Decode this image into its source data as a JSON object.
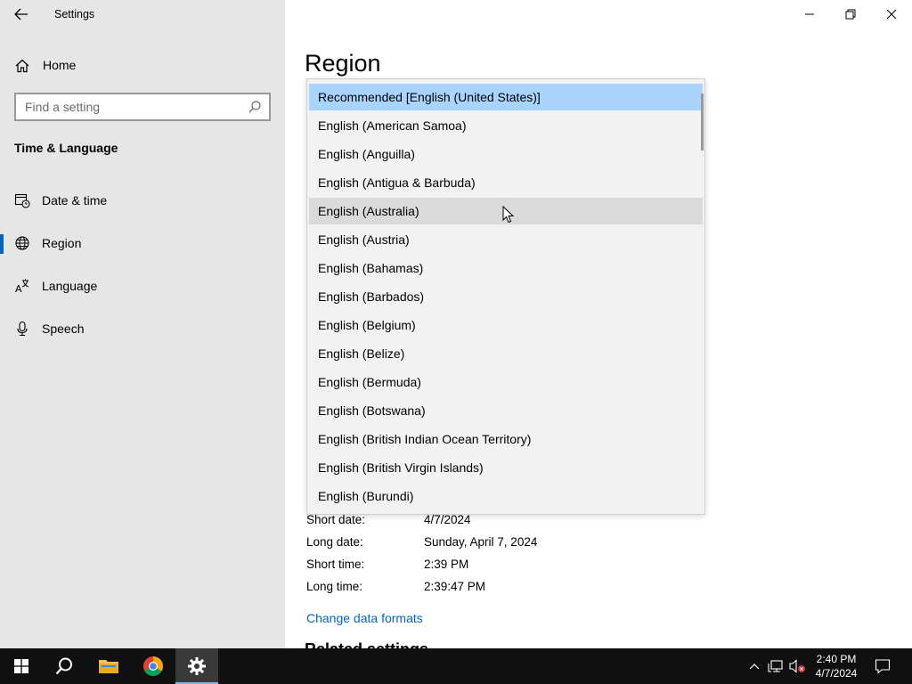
{
  "window": {
    "title": "Settings"
  },
  "sidebar": {
    "home_label": "Home",
    "search_placeholder": "Find a setting",
    "section_title": "Time & Language",
    "items": [
      {
        "label": "Date & time",
        "icon": "calendar-clock-icon"
      },
      {
        "label": "Region",
        "icon": "globe-icon",
        "active": true
      },
      {
        "label": "Language",
        "icon": "language-icon"
      },
      {
        "label": "Speech",
        "icon": "microphone-icon"
      }
    ]
  },
  "main": {
    "title": "Region",
    "dropdown": {
      "items": [
        "Recommended [English (United States)]",
        "English (American Samoa)",
        "English (Anguilla)",
        "English (Antigua & Barbuda)",
        "English (Australia)",
        "English (Austria)",
        "English (Bahamas)",
        "English (Barbados)",
        "English (Belgium)",
        "English (Belize)",
        "English (Bermuda)",
        "English (Botswana)",
        "English (British Indian Ocean Territory)",
        "English (British Virgin Islands)",
        "English (Burundi)"
      ],
      "selected_index": 0,
      "hover_index": 4
    },
    "formats": [
      {
        "label": "Short date:",
        "value": "4/7/2024"
      },
      {
        "label": "Long date:",
        "value": "Sunday, April 7, 2024"
      },
      {
        "label": "Short time:",
        "value": "2:39 PM"
      },
      {
        "label": "Long time:",
        "value": "2:39:47 PM"
      }
    ],
    "change_formats_link": "Change data formats",
    "related_heading": "Related settings"
  },
  "taskbar": {
    "time": "2:40 PM",
    "date": "4/7/2024"
  },
  "colors": {
    "accent": "#0067c0",
    "selected_item": "#a8d4ff",
    "sidebar_bg": "#e6e6e6",
    "taskbar_bg": "#101010"
  }
}
